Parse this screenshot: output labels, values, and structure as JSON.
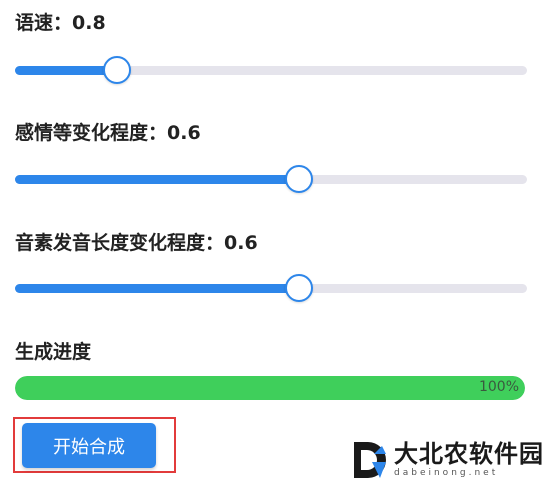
{
  "controls": {
    "speed": {
      "label": "语速：0.8",
      "value": 0.8,
      "position_fraction": 0.2
    },
    "emotion": {
      "label": "感情等变化程度：0.6",
      "value": 0.6,
      "position_fraction": 0.555
    },
    "phoneme_duration": {
      "label": "音素发音长度变化程度：0.6",
      "value": 0.6,
      "position_fraction": 0.555
    }
  },
  "progress": {
    "label": "生成进度",
    "percent": 100,
    "percent_text": "100%"
  },
  "start_button": {
    "label": "开始合成"
  },
  "watermark": {
    "title": "大北农软件园",
    "url": "dabeinong.net",
    "logo_letter": "D"
  },
  "colors": {
    "accent": "#2d86ea",
    "track": "#e5e4ec",
    "progress_fill": "#3fcf5b",
    "highlight_border": "#e23b3b"
  }
}
